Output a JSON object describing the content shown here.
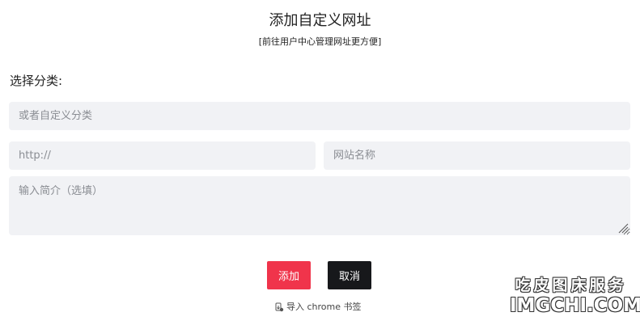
{
  "header": {
    "title": "添加自定义网址",
    "subtitle_open": "[",
    "subtitle_link": "前往用户中心管理网址更方便",
    "subtitle_close": "]"
  },
  "form": {
    "category_label": "选择分类:",
    "category_placeholder": "或者自定义分类",
    "url_placeholder": "http://",
    "name_placeholder": "网站名称",
    "description_placeholder": "输入简介（选填）"
  },
  "actions": {
    "add_label": "添加",
    "cancel_label": "取消",
    "import_label": "导入 chrome 书签",
    "import_icon": "bookmark-import-icon"
  },
  "watermark": {
    "line1": "吃皮图床服务",
    "line2": "IMGCHI.COM"
  },
  "colors": {
    "primary": "#f0344b",
    "dark": "#17181b",
    "field_background": "#f1f2f5"
  }
}
